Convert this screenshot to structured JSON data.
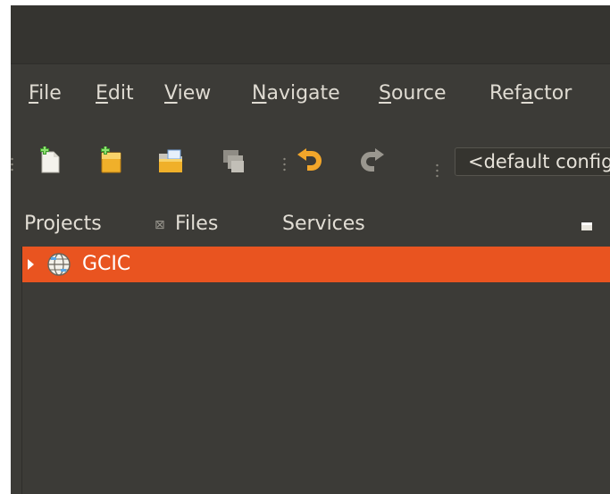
{
  "menubar": {
    "items": [
      {
        "pre": "",
        "key": "F",
        "post": "ile"
      },
      {
        "pre": "",
        "key": "E",
        "post": "dit"
      },
      {
        "pre": "",
        "key": "V",
        "post": "iew"
      },
      {
        "pre": "",
        "key": "N",
        "post": "avigate"
      },
      {
        "pre": "",
        "key": "S",
        "post": "ource"
      },
      {
        "pre": "Ref",
        "key": "a",
        "post": "ctor"
      }
    ]
  },
  "toolbar": {
    "buttons": [
      {
        "icon": "new-file-icon"
      },
      {
        "icon": "new-project-icon"
      },
      {
        "icon": "open-project-icon"
      },
      {
        "icon": "close-project-icon"
      },
      {
        "icon": "undo-icon"
      },
      {
        "icon": "redo-icon"
      }
    ],
    "config_value": "<default config>"
  },
  "panel": {
    "tabs": [
      {
        "label": "Projects",
        "close_glyph": "⊠",
        "active": true
      },
      {
        "label": "Files"
      },
      {
        "label": "Services"
      }
    ]
  },
  "tree": {
    "nodes": [
      {
        "label": "GCIC",
        "icon": "web-project-globe-icon",
        "selected": true,
        "expanded": false
      }
    ]
  },
  "colors": {
    "selection": "#e95420",
    "background": "#3c3b37",
    "titlebar": "#353430"
  }
}
